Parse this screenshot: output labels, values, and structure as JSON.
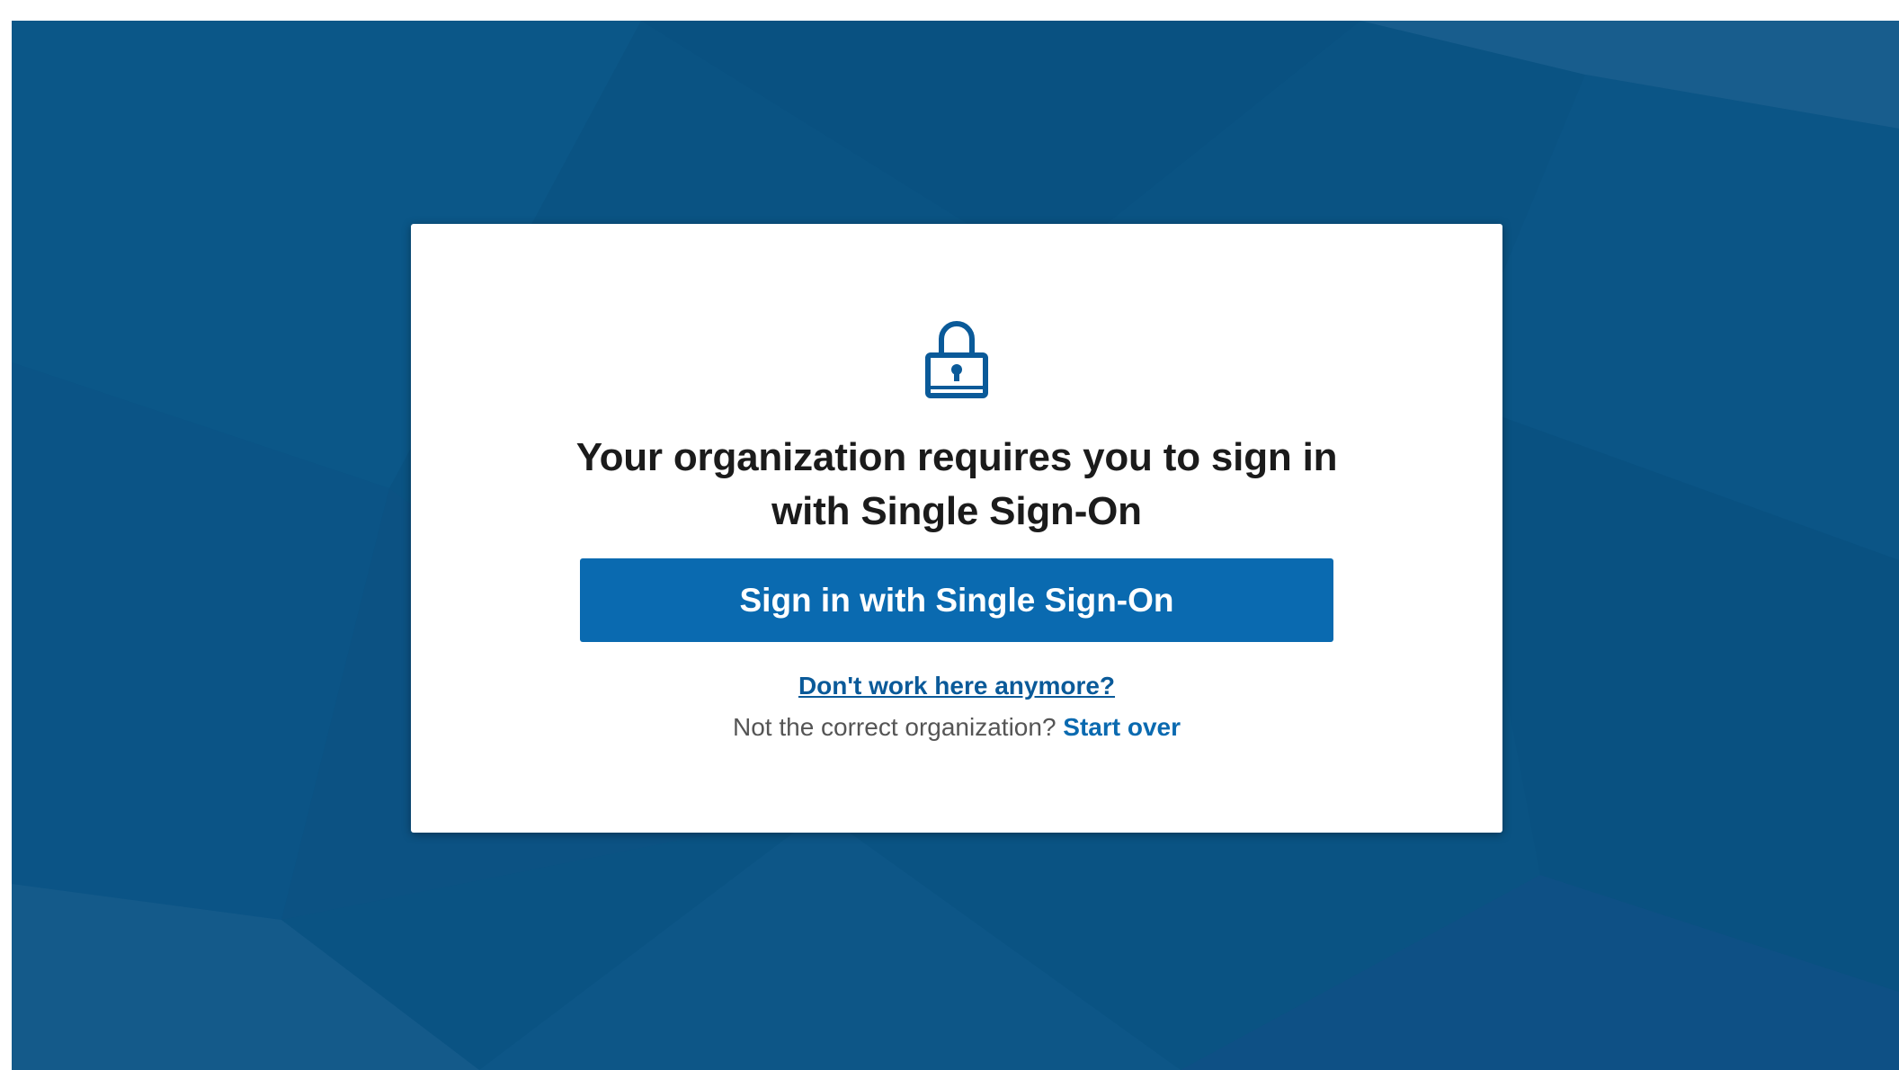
{
  "background": {
    "color": "#0a5383"
  },
  "dialog": {
    "icon": "lock-icon",
    "heading": "Your organization requires you to sign in with Single Sign-On",
    "sso_button_label": "Sign in with Single Sign-On",
    "leave_link": "Don't work here anymore?",
    "org_prompt": "Not the correct organization?",
    "start_over_link": "Start over"
  },
  "colors": {
    "accent": "#0a6ab0",
    "link": "#0a5a99",
    "heading": "#1b1b1b",
    "muted_text": "#555555",
    "card": "#ffffff"
  }
}
